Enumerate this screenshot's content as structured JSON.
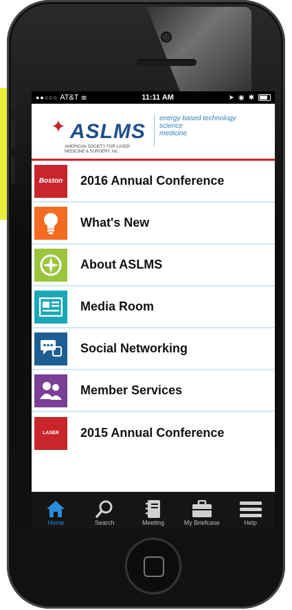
{
  "status_bar": {
    "signal": "●●○○○",
    "carrier": "AT&T",
    "time": "11:11 AM"
  },
  "header": {
    "logo_text": "ASLMS",
    "logo_subtext": "AMERICAN SOCIETY FOR LASER MEDICINE & SURGERY, Inc.",
    "tagline_1": "energy based technology",
    "tagline_2": "science",
    "tagline_3": "medicine"
  },
  "menu": {
    "items": [
      {
        "label": "2016 Annual Conference",
        "icon": "boston-logo-icon",
        "color": "#c8262c",
        "tile_text": "Boston"
      },
      {
        "label": "What's New",
        "icon": "lightbulb-icon",
        "color": "#f36b21",
        "tile_text": ""
      },
      {
        "label": "About ASLMS",
        "icon": "compass-icon",
        "color": "#9bc53d",
        "tile_text": ""
      },
      {
        "label": "Media Room",
        "icon": "newspaper-icon",
        "color": "#1aa7b8",
        "tile_text": ""
      },
      {
        "label": "Social Networking",
        "icon": "chat-icon",
        "color": "#1d5f93",
        "tile_text": ""
      },
      {
        "label": "Member Services",
        "icon": "people-icon",
        "color": "#7b3f97",
        "tile_text": ""
      },
      {
        "label": "2015 Annual Conference",
        "icon": "laser-logo-icon",
        "color": "#c8262c",
        "tile_text": "LASER"
      }
    ]
  },
  "tabbar": {
    "tabs": [
      {
        "label": "Home",
        "icon": "home-icon",
        "active": true
      },
      {
        "label": "Search",
        "icon": "search-icon",
        "active": false
      },
      {
        "label": "Meeting",
        "icon": "notebook-icon",
        "active": false
      },
      {
        "label": "My Briefcase",
        "icon": "briefcase-icon",
        "active": false
      },
      {
        "label": "Help",
        "icon": "menu-icon",
        "active": false
      }
    ]
  },
  "colors": {
    "accent_blue": "#2a8bd8",
    "brand_red": "#c8262c",
    "separator": "#cfe6f6"
  }
}
